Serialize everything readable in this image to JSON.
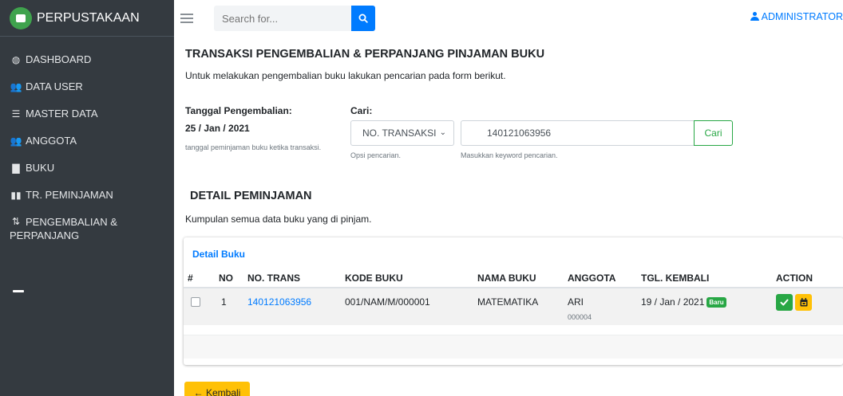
{
  "brand": {
    "name": "PERPUSTAKAAN"
  },
  "sidebar": {
    "items": [
      {
        "icon": "dashboard-icon",
        "glyph": "◍",
        "label": "DASHBOARD"
      },
      {
        "icon": "users-icon",
        "glyph": "👥",
        "label": "DATA USER"
      },
      {
        "icon": "database-icon",
        "glyph": "☰",
        "label": "MASTER DATA"
      },
      {
        "icon": "members-icon",
        "glyph": "👥",
        "label": "ANGGOTA"
      },
      {
        "icon": "book-icon",
        "glyph": "▇",
        "label": "BUKU"
      },
      {
        "icon": "open-book-icon",
        "glyph": "▮▮",
        "label": "TR. PEMINJAMAN"
      },
      {
        "icon": "return-icon",
        "glyph": "⇅",
        "label_line1": "PENGEMBALIAN &",
        "label_line2": "PERPANJANG"
      }
    ]
  },
  "topbar": {
    "search_placeholder": "Search for...",
    "user_label": "ADMINISTRATOR"
  },
  "page": {
    "title": "TRANSAKSI PENGEMBALIAN & PERPANJANG PINJAMAN BUKU",
    "description": "Untuk melakukan pengembalian buku lakukan pencarian pada form berikut."
  },
  "form": {
    "date_label": "Tanggal Pengembalian:",
    "date_value": "25 / Jan / 2021",
    "date_hint": "tanggal peminjaman buku ketika transaksi.",
    "search_label": "Cari:",
    "select_value": "NO. TRANSAKSI",
    "select_hint": "Opsi pencarian.",
    "keyword_value": "140121063956",
    "keyword_hint": "Masukkan keyword pencarian.",
    "search_button": "Cari"
  },
  "detail": {
    "title": "DETAIL PEMINJAMAN",
    "description": "Kumpulan semua data buku yang di pinjam."
  },
  "table": {
    "card_title": "Detail Buku",
    "headers": [
      "#",
      "NO",
      "NO. TRANS",
      "KODE BUKU",
      "NAMA BUKU",
      "ANGGOTA",
      "TGL. KEMBALI",
      "ACTION"
    ],
    "rows": [
      {
        "no": "1",
        "no_trans": "140121063956",
        "kode_buku": "001/NAM/M/000001",
        "nama_buku": "MATEMATIKA",
        "anggota": "ARI",
        "anggota_id": "000004",
        "tgl_kembali": "19 / Jan / 2021",
        "badge": "Baru"
      }
    ]
  },
  "back_button": "Kembali",
  "colors": {
    "sidebar_bg": "#343a40",
    "primary": "#007bff",
    "success": "#28a745",
    "warning": "#ffc107"
  }
}
